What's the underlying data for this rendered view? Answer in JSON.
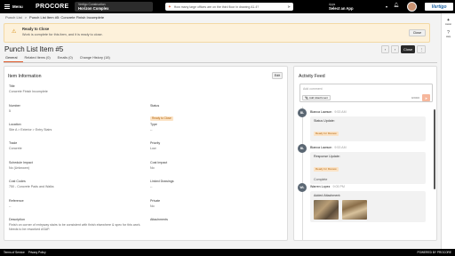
{
  "topbar": {
    "menu_label": "Menu",
    "brand": "PROCORE",
    "company": "Vertigo Construction",
    "project": "Horizon Complex",
    "search_text": "How many large offices are on the third floor in drawing A1.4?",
    "apps_label": "Apps",
    "apps_value": "Select an App",
    "logo_text": "Vertigo"
  },
  "rail": {
    "item1": "Assist",
    "item2": "Help"
  },
  "breadcrumb": {
    "root": "Punch List",
    "sep": ">",
    "current": "Punch List Item #5: Concrete Finish Incomplete"
  },
  "banner": {
    "title": "Ready to Close",
    "body": "Work is complete for this item, and it is ready to close.",
    "close": "Close"
  },
  "page": {
    "title": "Punch List Item #5",
    "prev": "‹",
    "next": "›",
    "close": "Close",
    "more": "⋮"
  },
  "tabs": [
    "General",
    "Related Items (0)",
    "Emails (0)",
    "Change History (18)"
  ],
  "item_info": {
    "heading": "Item Information",
    "edit": "Edit",
    "title_label": "Title",
    "title_value": "Concrete Finish Incomplete",
    "number_label": "Number",
    "number_value": "5",
    "status_label": "Status",
    "status_value": "Ready to Close",
    "location_label": "Location",
    "location_value": "Site A > Exterior > Entry Stairs",
    "type_label": "Type",
    "type_value": "--",
    "trade_label": "Trade",
    "trade_value": "Concrete",
    "priority_label": "Priority",
    "priority_value": "Low",
    "schedule_label": "Schedule Impact",
    "schedule_value": "No (Unknown)",
    "cost_impact_label": "Cost Impact",
    "cost_impact_value": "No",
    "cost_codes_label": "Cost Codes",
    "cost_codes_value": "750 - Concrete Pads and Walks",
    "linked_label": "Linked Drawings",
    "linked_value": "--",
    "reference_label": "Reference",
    "reference_value": "--",
    "private_label": "Private",
    "private_value": "No",
    "description_label": "Description",
    "description_value": "Finish on corner of entryway stairs to be consistent with finish elsewhere & spec for this work. Needs to be reworked ASAP.",
    "attachments_label": "Attachments"
  },
  "feed": {
    "heading": "Activity Feed",
    "placeholder": "Add comment",
    "add_attachment": "Add Attachment",
    "count": "0/2000",
    "entries": [
      {
        "initials": "BL",
        "name": "Bianca Lawson",
        "time": "9:53 AM",
        "text": "Status Update:",
        "pill": "Ready for Review",
        "extra": ""
      },
      {
        "initials": "BL",
        "name": "Bianca Lawson",
        "time": "9:53 AM",
        "text": "Response Update:",
        "pill": "Ready for Review",
        "extra": "Complete"
      },
      {
        "initials": "WL",
        "name": "Warren Lopez",
        "time": "9:05 PM",
        "text": "Added Attachment:",
        "pill": "",
        "extra": ""
      }
    ]
  },
  "footer": {
    "terms": "Terms of Service",
    "privacy": "Privacy Policy",
    "powered": "POWERED BY PROCORE"
  }
}
